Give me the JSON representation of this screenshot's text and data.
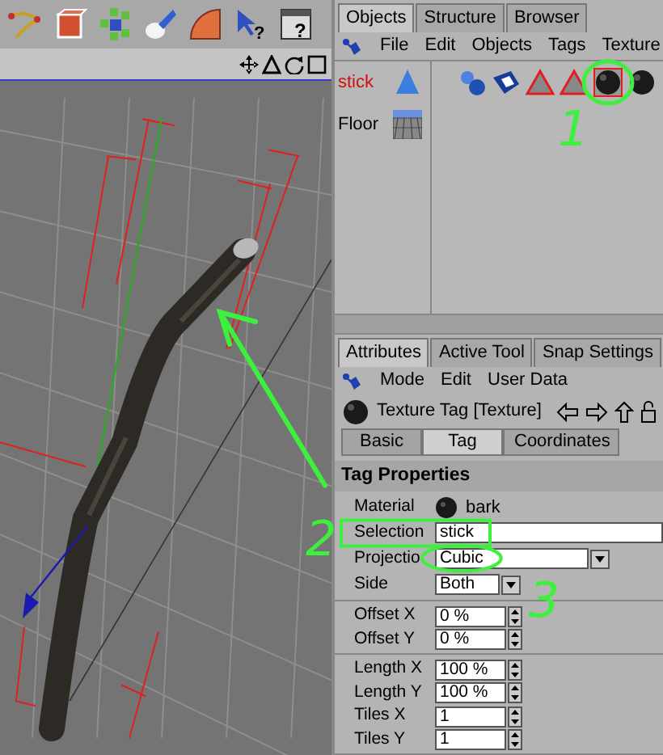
{
  "toolbar": [
    {
      "kind": "help-pointer",
      "mark": "?"
    },
    {
      "kind": "help-window",
      "mark": "?"
    }
  ],
  "objects_panel": {
    "tabs": [
      {
        "label": "Objects",
        "selected": true
      },
      {
        "label": "Structure",
        "selected": false
      },
      {
        "label": "Browser",
        "selected": false
      }
    ],
    "menu": [
      "File",
      "Edit",
      "Objects",
      "Tags",
      "Texture"
    ],
    "objects": [
      {
        "name": "stick",
        "kind": "polygon",
        "selected": true,
        "tags": [
          {
            "kind": "spheres",
            "selected": false
          },
          {
            "kind": "checker",
            "selected": false
          },
          {
            "kind": "triangle",
            "selected": false
          },
          {
            "kind": "triangle",
            "selected": false
          },
          {
            "kind": "ball",
            "selected": true
          },
          {
            "kind": "ball",
            "selected": false
          }
        ]
      },
      {
        "name": "Floor",
        "kind": "floor",
        "selected": false
      }
    ]
  },
  "attributes_panel": {
    "tabs": [
      {
        "label": "Attributes",
        "selected": true
      },
      {
        "label": "Active Tool",
        "selected": false
      },
      {
        "label": "Snap Settings",
        "selected": false
      }
    ],
    "menu": [
      "Mode",
      "Edit",
      "User Data"
    ],
    "title": "Texture Tag [Texture]",
    "subtabs": [
      {
        "label": "Basic",
        "selected": false
      },
      {
        "label": "Tag",
        "selected": true
      },
      {
        "label": "Coordinates",
        "selected": false
      }
    ],
    "section": "Tag Properties",
    "field_groups": [
      [
        {
          "kind": "material",
          "label": "Material",
          "value": "bark"
        },
        {
          "kind": "text",
          "label": "Selection",
          "value": "stick"
        },
        {
          "kind": "dropdown",
          "label": "Projectio",
          "value": "Cubic"
        },
        {
          "kind": "dropdown",
          "label": "Side",
          "value": "Both"
        }
      ],
      [
        {
          "kind": "spinner",
          "label": "Offset X",
          "value": "0 %"
        },
        {
          "kind": "spinner",
          "label": "Offset Y",
          "value": "0 %"
        }
      ],
      [
        {
          "kind": "spinner",
          "label": "Length X",
          "value": "100 %"
        },
        {
          "kind": "spinner",
          "label": "Length Y",
          "value": "100 %"
        },
        {
          "kind": "spinner",
          "label": "Tiles X",
          "value": "1"
        },
        {
          "kind": "spinner",
          "label": "Tiles Y",
          "value": "1"
        }
      ]
    ]
  },
  "annotations": [
    {
      "text": "1"
    },
    {
      "text": "2"
    },
    {
      "text": "3"
    }
  ]
}
